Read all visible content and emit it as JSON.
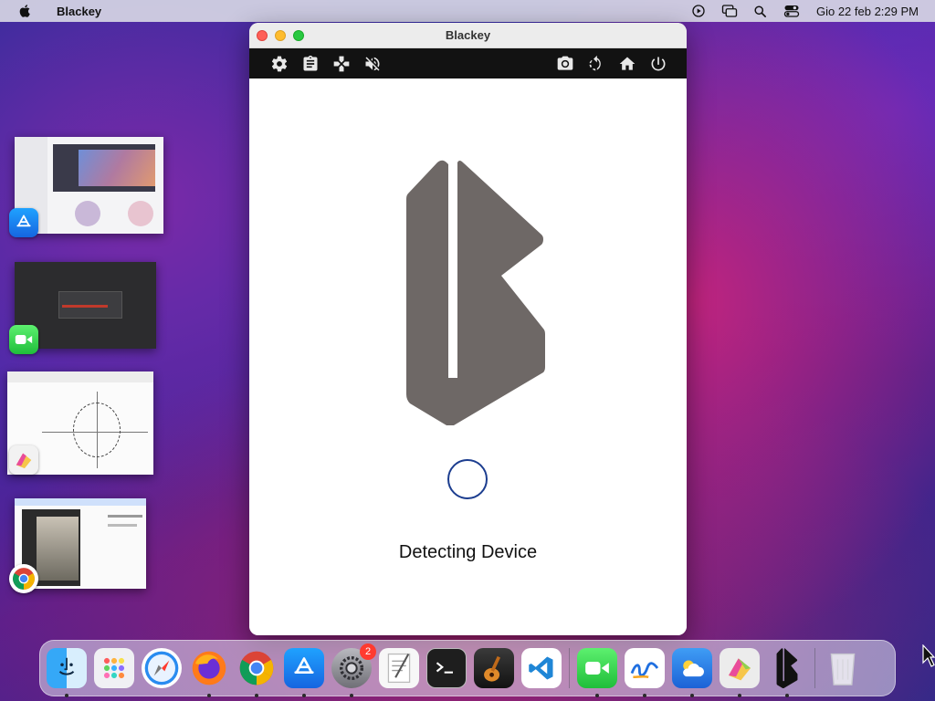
{
  "menubar": {
    "app_name": "Blackey",
    "clock": "Gio 22 feb  2:29 PM",
    "icons": [
      "apple-icon",
      "play-circle-icon",
      "screen-mirroring-icon",
      "search-icon",
      "control-center-icon"
    ]
  },
  "window": {
    "title": "Blackey",
    "toolbar": {
      "left": [
        "gear-icon",
        "clipboard-icon",
        "gamepad-icon",
        "mute-icon"
      ],
      "right": [
        "camera-icon",
        "rotate-icon",
        "home-icon",
        "power-icon"
      ]
    },
    "status": "Detecting Device",
    "colors": {
      "logo": "#6e6866",
      "spinner": "#1c3d8f",
      "toolbar_bg": "#121212"
    }
  },
  "stage_manager": [
    {
      "app": "App Store",
      "icon": "app-store-icon"
    },
    {
      "app": "FaceTime",
      "icon": "facetime-icon"
    },
    {
      "app": "Grapher",
      "icon": "grapher-icon"
    },
    {
      "app": "Google Chrome",
      "icon": "chrome-icon"
    }
  ],
  "dock": {
    "items": [
      {
        "app": "Finder",
        "icon": "finder-icon",
        "running": true
      },
      {
        "app": "Launchpad",
        "icon": "launchpad-icon",
        "running": false
      },
      {
        "app": "Safari",
        "icon": "safari-icon",
        "running": false
      },
      {
        "app": "Firefox",
        "icon": "firefox-icon",
        "running": true
      },
      {
        "app": "Google Chrome",
        "icon": "chrome-icon",
        "running": true
      },
      {
        "app": "App Store",
        "icon": "app-store-icon",
        "running": true
      },
      {
        "app": "System Settings",
        "icon": "settings-icon",
        "running": true,
        "badge": "2"
      },
      {
        "app": "TextEdit",
        "icon": "textedit-icon",
        "running": false
      },
      {
        "app": "Terminal",
        "icon": "terminal-icon",
        "running": false
      },
      {
        "app": "GarageBand",
        "icon": "garageband-icon",
        "running": false
      },
      {
        "app": "Visual Studio Code",
        "icon": "vscode-icon",
        "running": false
      }
    ],
    "recent": [
      {
        "app": "FaceTime",
        "icon": "facetime-icon",
        "running": true
      },
      {
        "app": "Freeform",
        "icon": "freeform-icon",
        "running": true
      },
      {
        "app": "Weather",
        "icon": "weather-icon",
        "running": true
      },
      {
        "app": "Grapher",
        "icon": "grapher-icon",
        "running": true
      },
      {
        "app": "Blackey",
        "icon": "blackey-icon",
        "running": true
      }
    ],
    "trash": {
      "app": "Trash",
      "icon": "trash-icon"
    }
  }
}
